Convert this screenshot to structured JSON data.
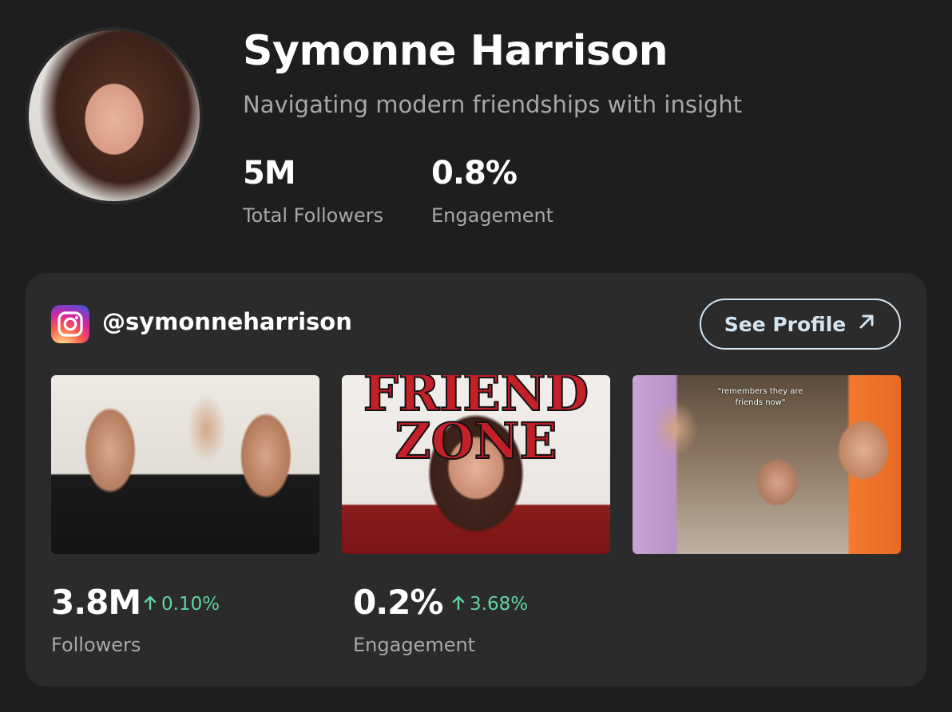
{
  "profile": {
    "name": "Symonne Harrison",
    "tagline": "Navigating modern friendships with insight",
    "stats": [
      {
        "value": "5M",
        "label": "Total Followers"
      },
      {
        "value": "0.8%",
        "label": "Engagement"
      }
    ]
  },
  "instagram": {
    "platform_icon": "instagram-icon",
    "handle": "@symonneharrison",
    "see_profile_label": "See Profile",
    "see_profile_icon": "arrow-up-right-icon",
    "posts": [
      {
        "thumbnail": "group-photo",
        "overlay_text": ""
      },
      {
        "thumbnail": "friend-zone-poster",
        "overlay_text": "FRIEND ZONE"
      },
      {
        "thumbnail": "friends-video-still",
        "overlay_text": "\"remembers they are friends now\""
      }
    ],
    "metrics": [
      {
        "value": "3.8M",
        "change": "0.10%",
        "direction": "up",
        "label": "Followers"
      },
      {
        "value": "0.2%",
        "change": "3.68%",
        "direction": "up",
        "label": "Engagement"
      }
    ]
  },
  "colors": {
    "background": "#1e1e1e",
    "panel": "#2b2b2b",
    "muted_text": "#a8a8a8",
    "positive": "#5fd6a2",
    "button_outline": "#d4e4f1"
  }
}
